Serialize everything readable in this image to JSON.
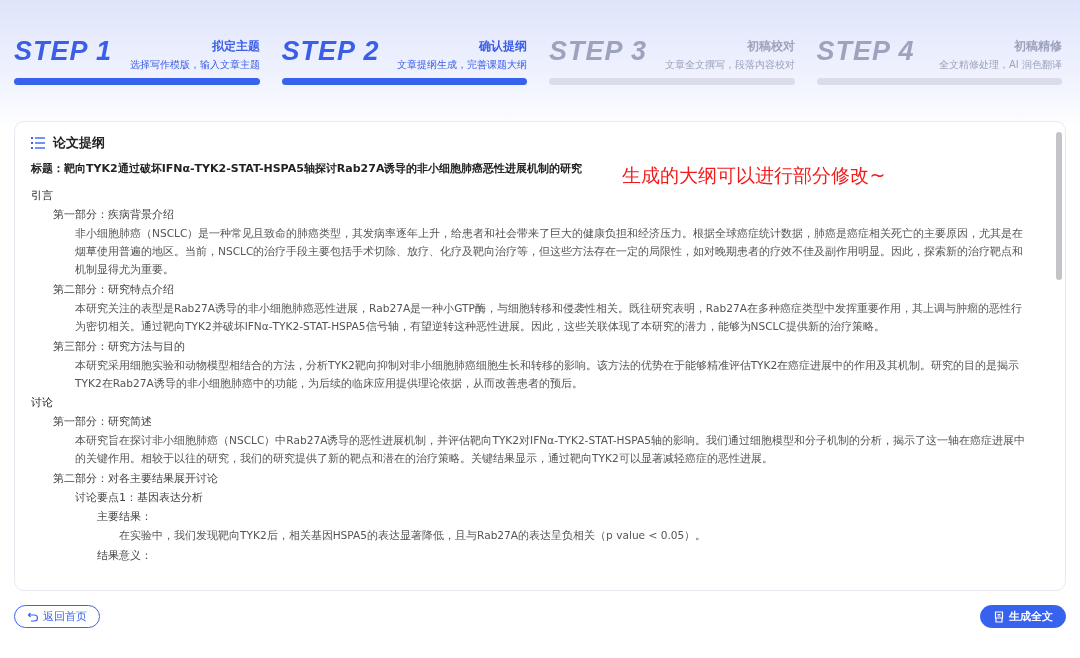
{
  "steps": [
    {
      "label": "STEP 1",
      "title": "拟定主题",
      "subtitle": "选择写作模版，输入文章主题",
      "active": true
    },
    {
      "label": "STEP 2",
      "title": "确认提纲",
      "subtitle": "文章提纲生成，完善课题大纲",
      "active": true
    },
    {
      "label": "STEP 3",
      "title": "初稿校对",
      "subtitle": "文章全文撰写，段落内容校对",
      "active": false
    },
    {
      "label": "STEP 4",
      "title": "初稿精修",
      "subtitle": "全文精修处理，AI 润色翻译",
      "active": false
    }
  ],
  "outline": {
    "title": "论文提纲",
    "heading": "标题：靶向TYK2通过破坏IFNα-TYK2-STAT-HSPA5轴探讨Rab27A诱导的非小细胞肺癌恶性进展机制的研究",
    "annotation": "生成的大纲可以进行部分修改~",
    "items": [
      {
        "kind": "section",
        "text": "引言",
        "children": [
          {
            "kind": "part",
            "text": "第一部分：疾病背景介绍",
            "children": [
              {
                "kind": "para",
                "text": "非小细胞肺癌（NSCLC）是一种常见且致命的肺癌类型，其发病率逐年上升，给患者和社会带来了巨大的健康负担和经济压力。根据全球癌症统计数据，肺癌是癌症相关死亡的主要原因，尤其是在烟草使用普遍的地区。当前，NSCLC的治疗手段主要包括手术切除、放疗、化疗及靶向治疗等，但这些方法存在一定的局限性，如对晚期患者的疗效不佳及副作用明显。因此，探索新的治疗靶点和机制显得尤为重要。"
              }
            ]
          },
          {
            "kind": "part",
            "text": "第二部分：研究特点介绍",
            "children": [
              {
                "kind": "para",
                "text": "本研究关注的表型是Rab27A诱导的非小细胞肺癌恶性进展，Rab27A是一种小GTP酶，与细胞转移和侵袭性相关。既往研究表明，Rab27A在多种癌症类型中发挥重要作用，其上调与肿瘤的恶性行为密切相关。通过靶向TYK2并破坏IFNα-TYK2-STAT-HSPA5信号轴，有望逆转这种恶性进展。因此，这些关联体现了本研究的潜力，能够为NSCLC提供新的治疗策略。"
              }
            ]
          },
          {
            "kind": "part",
            "text": "第三部分：研究方法与目的",
            "children": [
              {
                "kind": "para",
                "text": "本研究采用细胞实验和动物模型相结合的方法，分析TYK2靶向抑制对非小细胞肺癌细胞生长和转移的影响。该方法的优势在于能够精准评估TYK2在癌症进展中的作用及其机制。研究的目的是揭示TYK2在Rab27A诱导的非小细胞肺癌中的功能，为后续的临床应用提供理论依据，从而改善患者的预后。"
              }
            ]
          }
        ]
      },
      {
        "kind": "section",
        "text": "讨论",
        "children": [
          {
            "kind": "part",
            "text": "第一部分：研究简述",
            "children": [
              {
                "kind": "para",
                "text": "本研究旨在探讨非小细胞肺癌（NSCLC）中Rab27A诱导的恶性进展机制，并评估靶向TYK2对IFNα-TYK2-STAT-HSPA5轴的影响。我们通过细胞模型和分子机制的分析，揭示了这一轴在癌症进展中的关键作用。相较于以往的研究，我们的研究提供了新的靶点和潜在的治疗策略。关键结果显示，通过靶向TYK2可以显著减轻癌症的恶性进展。"
              }
            ]
          },
          {
            "kind": "part",
            "text": "第二部分：对各主要结果展开讨论",
            "children": [
              {
                "kind": "part",
                "text": "讨论要点1：基因表达分析",
                "children": [
                  {
                    "kind": "part",
                    "text": "主要结果：",
                    "children": [
                      {
                        "kind": "para",
                        "text": "在实验中，我们发现靶向TYK2后，相关基因HSPA5的表达显著降低，且与Rab27A的表达呈负相关（p value < 0.05）。"
                      }
                    ]
                  },
                  {
                    "kind": "part",
                    "text": "结果意义："
                  }
                ]
              }
            ]
          }
        ]
      }
    ]
  },
  "buttons": [
    {
      "kind": "back",
      "label": "返回首页"
    },
    {
      "kind": "primary",
      "label": "生成全文"
    }
  ]
}
